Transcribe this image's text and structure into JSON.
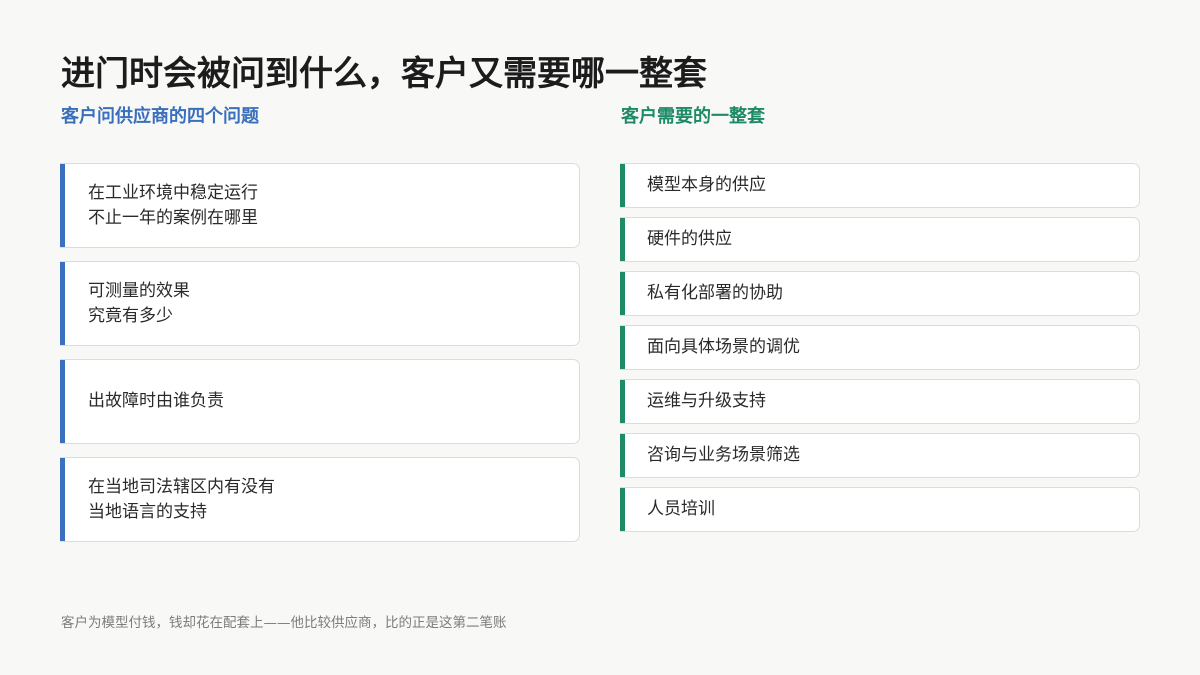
{
  "title": "进门时会被问到什么，客户又需要哪一整套",
  "left_column": {
    "heading": "客户问供应商的四个问题",
    "accent_color": "#3b6fc0",
    "questions": [
      "在工业环境中稳定运行\n不止一年的案例在哪里",
      "可测量的效果\n究竟有多少",
      "出故障时由谁负责",
      "在当地司法辖区内有没有\n当地语言的支持"
    ]
  },
  "right_column": {
    "heading": "客户需要的一整套",
    "accent_color": "#1f8a68",
    "items": [
      "模型本身的供应",
      "硬件的供应",
      "私有化部署的协助",
      "面向具体场景的调优",
      "运维与升级支持",
      "咨询与业务场景筛选",
      "人员培训"
    ]
  },
  "footer": "客户为模型付钱，钱却花在配套上——他比较供应商，比的正是这第二笔账"
}
